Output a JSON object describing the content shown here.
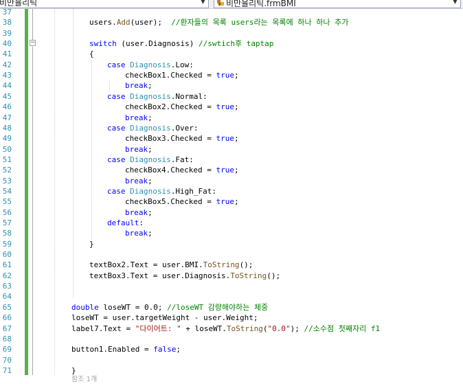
{
  "navbar": {
    "left_combo": "비만율리틱",
    "right_combo": "비만율리틱.frmBMI"
  },
  "line_numbers": [
    "37",
    "38",
    "39",
    "40",
    "41",
    "42",
    "43",
    "44",
    "45",
    "46",
    "47",
    "48",
    "49",
    "50",
    "51",
    "52",
    "53",
    "54",
    "55",
    "56",
    "57",
    "58",
    "59",
    "60",
    "61",
    "62",
    "63",
    "64",
    "65",
    "66",
    "67",
    "68",
    "69",
    "70",
    "71"
  ],
  "code": {
    "l38_a": "users.",
    "l38_b": "Add",
    "l38_c": "(user);  ",
    "l38_comment": "//환자들의 목록 users라는 목록에 하나 하나 추가",
    "l40_kw": "switch",
    "l40_a": " (user.Diagnosis) ",
    "l40_comment": "//swtich후 taptap",
    "l41": "{",
    "case_kw": "case",
    "diagnosis_type": "Diagnosis",
    "l42_tail": ".Low:",
    "l45_tail": ".Normal:",
    "l48_tail": ".Over:",
    "l51_tail": ".Fat:",
    "l54_tail": ".High_Fat:",
    "cb1": "checkBox1.Checked = ",
    "cb2": "checkBox2.Checked = ",
    "cb3": "checkBox3.Checked = ",
    "cb4": "checkBox4.Checked = ",
    "cb5": "checkBox5.Checked = ",
    "true_kw": "true",
    "semi": ";",
    "break_kw": "break",
    "default_kw": "default",
    "colon": ":",
    "l59": "}",
    "l61_a": "textBox2.Text = user.BMI.",
    "tostring": "ToString",
    "l61_b": "();",
    "l62_a": "textBox3.Text = user.Diagnosis.",
    "l62_b": "();",
    "double_kw": "double",
    "l65_var": " loseWT",
    "l65_a": " = 0.0; ",
    "l65_comment": "//loseWT 감량해야하는 체중",
    "l66": "loseWT = user.targetWeight - user.Weight;",
    "l67_a": "label7.Text = ",
    "l67_str": "\"다이어트: \"",
    "l67_b": " + loseWT.",
    "l67_c": "(",
    "l67_str2": "\"0.0\"",
    "l67_d": "); ",
    "l67_comment": "//소수점 첫째자리 f1",
    "l69_a": "button1.Enabled = ",
    "false_kw": "false",
    "l71": "}",
    "ref_hint": "참조 1개"
  }
}
